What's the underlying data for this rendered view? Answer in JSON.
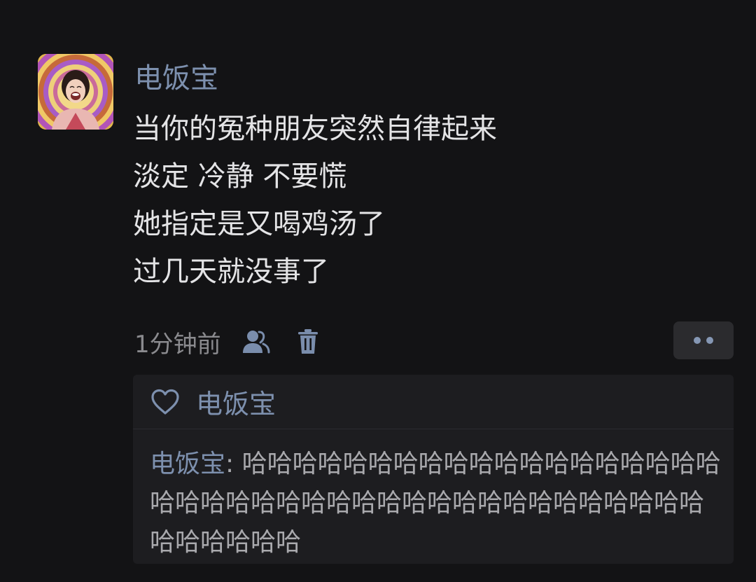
{
  "post": {
    "author": "电饭宝",
    "lines": [
      "当你的冤种朋友突然自律起来",
      "淡定 冷静 不要慌",
      "她指定是又喝鸡汤了",
      "过几天就没事了"
    ],
    "timestamp": "1分钟前"
  },
  "icons": {
    "visibility": "friends-visibility-icon",
    "delete": "trash-icon",
    "more": "more-dots-icon",
    "like": "heart-icon"
  },
  "likes": {
    "names": "电饭宝"
  },
  "comments": [
    {
      "author": "电饭宝",
      "separator": ": ",
      "text": "哈哈哈哈哈哈哈哈哈哈哈哈哈哈哈哈哈哈哈哈哈哈哈哈哈哈哈哈哈哈哈哈哈哈哈哈哈哈哈哈哈哈哈哈哈哈哈"
    }
  ],
  "colors": {
    "background": "#131315",
    "name_link": "#7d90ae",
    "panel": "#1d1d20"
  }
}
